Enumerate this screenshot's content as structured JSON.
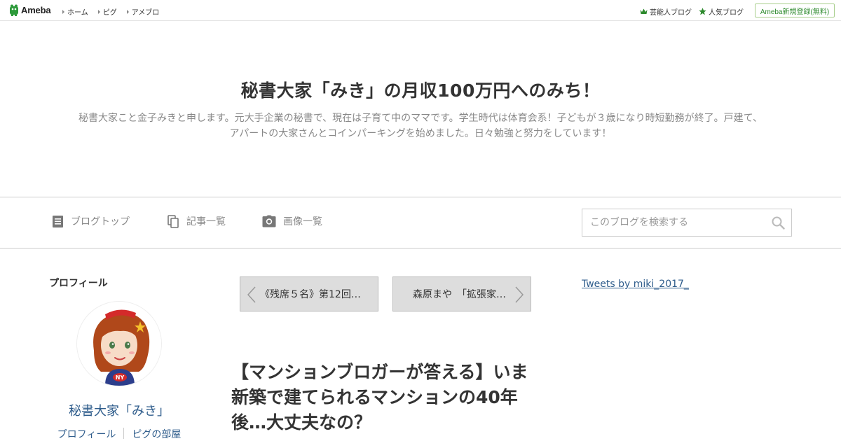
{
  "topbar": {
    "logo_text": "Ameba",
    "nav": [
      "ホーム",
      "ピグ",
      "アメブロ"
    ],
    "right_links": [
      "芸能人ブログ",
      "人気ブログ"
    ],
    "signup_label": "Ameba新規登録(無料)"
  },
  "header": {
    "title": "秘書大家「みき」の月収100万円へのみち！",
    "description_line1": "秘書大家こと金子みきと申します。元大手企業の秘書で、現在は子育て中のママです。学生時代は体育会系！子どもが３歳になり時短勤務が終了。戸建て、",
    "description_line2": "アパートの大家さんとコインパーキングを始めました。日々勉強と努力をしています！"
  },
  "navbar": {
    "items": [
      "ブログトップ",
      "記事一覧",
      "画像一覧"
    ],
    "search_placeholder": "このブログを検索する"
  },
  "sidebar": {
    "profile_heading": "プロフィール",
    "profile_name": "秘書大家「みき」",
    "links": [
      "プロフィール",
      "ピグの部屋"
    ]
  },
  "article": {
    "prev_label": "《残席５名》第12回…",
    "next_label": "森原まや　「拡張家…",
    "title": "【マンションブロガーが答える】いま新築で建てられるマンションの40年後…大丈夫なの？"
  },
  "right_column": {
    "tweets_link": "Tweets by miki_2017_"
  },
  "colors": {
    "accent_green": "#2d8a2d",
    "link_blue": "#2f5d8c"
  }
}
